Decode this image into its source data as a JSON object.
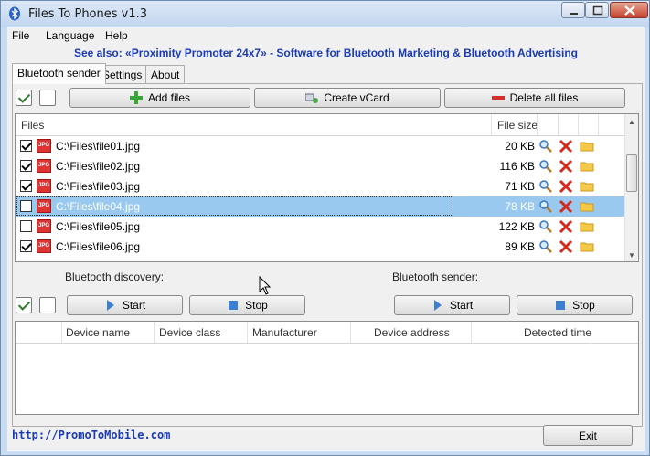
{
  "window": {
    "title": "Files To Phones v1.3"
  },
  "menu": [
    "File",
    "Language",
    "Help"
  ],
  "promo": "See also: «Proximity Promoter 24x7» - Software for Bluetooth Marketing & Bluetooth Advertising",
  "tabs": [
    "Bluetooth sender",
    "Settings",
    "About"
  ],
  "toolbar": {
    "add_files": "Add files",
    "create_vcard": "Create vCard",
    "delete_all": "Delete all files"
  },
  "files": {
    "columns": [
      "Files",
      "File size"
    ],
    "rows": [
      {
        "checked": true,
        "path": "C:\\Files\\file01.jpg",
        "size": "20 KB"
      },
      {
        "checked": true,
        "path": "C:\\Files\\file02.jpg",
        "size": "116 KB"
      },
      {
        "checked": true,
        "path": "C:\\Files\\file03.jpg",
        "size": "71 KB"
      },
      {
        "checked": false,
        "path": "C:\\Files\\file04.jpg",
        "size": "78 KB",
        "selected": true
      },
      {
        "checked": false,
        "path": "C:\\Files\\file05.jpg",
        "size": "122 KB"
      },
      {
        "checked": true,
        "path": "C:\\Files\\file06.jpg",
        "size": "89 KB"
      }
    ]
  },
  "discovery": {
    "label": "Bluetooth discovery:",
    "start": "Start",
    "stop": "Stop"
  },
  "sender": {
    "label": "Bluetooth sender:",
    "start": "Start",
    "stop": "Stop"
  },
  "devices": {
    "columns": [
      "Device name",
      "Device class",
      "Manufacturer",
      "Device address",
      "Detected time"
    ]
  },
  "footer": {
    "link": "http://PromoToMobile.com",
    "exit": "Exit"
  },
  "colors": {
    "promo": "#1a3bb5",
    "selected_row": "#99c9ef"
  }
}
